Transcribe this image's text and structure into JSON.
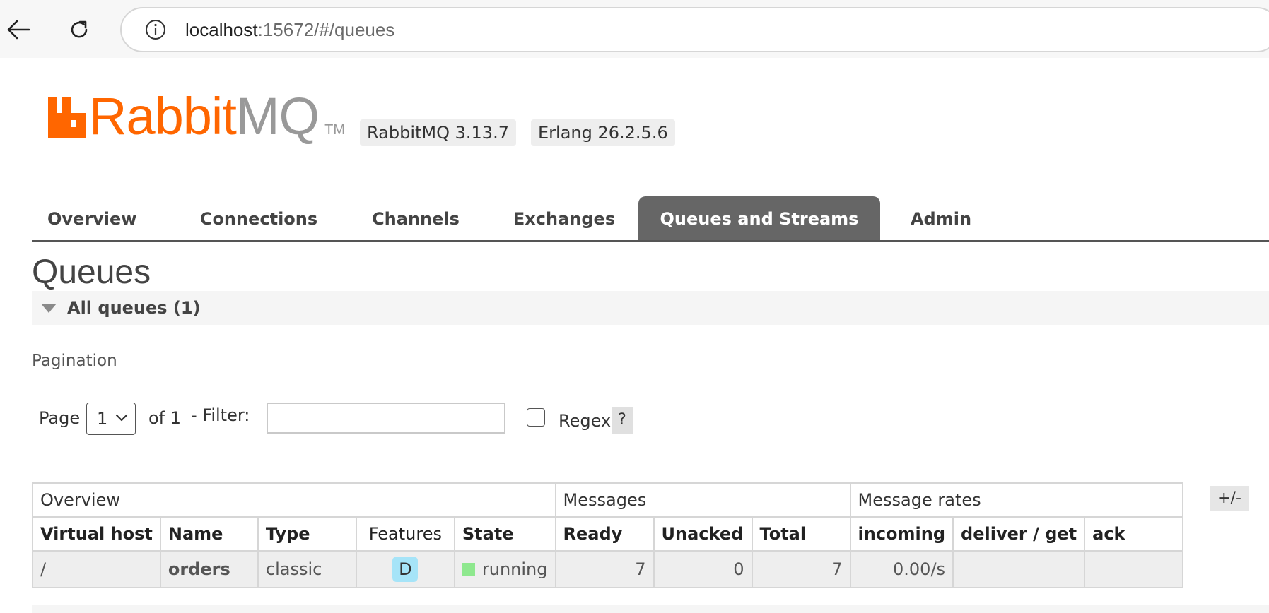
{
  "browser": {
    "url_host": "localhost",
    "url_rest": ":15672/#/queues"
  },
  "header": {
    "logo_rabbit": "Rabbit",
    "logo_mq": "MQ",
    "logo_tm": "TM",
    "rabbitmq_version": "RabbitMQ 3.13.7",
    "erlang_version": "Erlang 26.2.5.6",
    "brand_color": "#ff6600"
  },
  "tabs": [
    {
      "label": "Overview",
      "active": false
    },
    {
      "label": "Connections",
      "active": false
    },
    {
      "label": "Channels",
      "active": false
    },
    {
      "label": "Exchanges",
      "active": false
    },
    {
      "label": "Queues and Streams",
      "active": true
    },
    {
      "label": "Admin",
      "active": false
    }
  ],
  "page": {
    "title": "Queues",
    "section_title": "All queues (1)"
  },
  "pagination": {
    "label": "Pagination",
    "page_label": "Page",
    "page_value": "1",
    "of_label": "of 1",
    "filter_label": "- Filter:",
    "filter_value": "",
    "regex_label": "Regex",
    "regex_checked": false,
    "help_label": "?"
  },
  "table": {
    "groups": [
      "Overview",
      "Messages",
      "Message rates"
    ],
    "columns": [
      "Virtual host",
      "Name",
      "Type",
      "Features",
      "State",
      "Ready",
      "Unacked",
      "Total",
      "incoming",
      "deliver / get",
      "ack"
    ],
    "toggle_label": "+/-",
    "rows": [
      {
        "vhost": "/",
        "name": "orders",
        "type": "classic",
        "features": "D",
        "state": "running",
        "ready": "7",
        "unacked": "0",
        "total": "7",
        "incoming": "0.00/s",
        "deliver_get": "",
        "ack": ""
      }
    ]
  }
}
